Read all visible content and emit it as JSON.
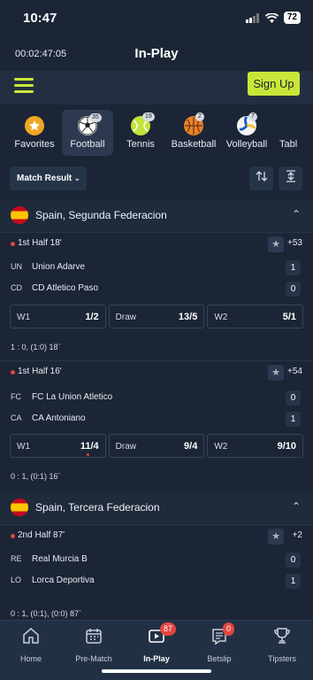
{
  "status_bar": {
    "time": "10:47",
    "battery": "72"
  },
  "top_bar": {
    "timer": "00:02:47:05",
    "title": "In-Play"
  },
  "header": {
    "signup_label": "Sign Up"
  },
  "sports": [
    {
      "label": "Favorites",
      "count": ""
    },
    {
      "label": "Football",
      "count": "35"
    },
    {
      "label": "Tennis",
      "count": "19"
    },
    {
      "label": "Basketball",
      "count": "2"
    },
    {
      "label": "Volleyball",
      "count": "7"
    },
    {
      "label": "Tabl",
      "count": ""
    }
  ],
  "filter": {
    "market_label": "Match Result"
  },
  "leagues": [
    {
      "name": "Spain, Segunda Federacion"
    },
    {
      "name": "Spain, Tercera Federacion"
    }
  ],
  "matches": [
    {
      "period": "1st Half 18'",
      "more": "+53",
      "home": {
        "abbr": "UN",
        "name": "Union Adarve",
        "score": "1"
      },
      "away": {
        "abbr": "CD",
        "name": "CD Atletico Paso",
        "score": "0"
      },
      "odds": [
        {
          "label": "W1",
          "value": "1/2"
        },
        {
          "label": "Draw",
          "value": "13/5"
        },
        {
          "label": "W2",
          "value": "5/1"
        }
      ],
      "info": "1 : 0, (1:0) 18`"
    },
    {
      "period": "1st Half 16'",
      "more": "+54",
      "home": {
        "abbr": "FC",
        "name": "FC La Union Atletico",
        "score": "0"
      },
      "away": {
        "abbr": "CA",
        "name": "CA Antoniano",
        "score": "1"
      },
      "odds": [
        {
          "label": "W1",
          "value": "11/4"
        },
        {
          "label": "Draw",
          "value": "9/4"
        },
        {
          "label": "W2",
          "value": "9/10"
        }
      ],
      "info": "0 : 1, (0:1) 16`"
    },
    {
      "period": "2nd Half 87'",
      "more": "+2",
      "home": {
        "abbr": "RE",
        "name": "Real Murcia B",
        "score": "0"
      },
      "away": {
        "abbr": "LO",
        "name": "Lorca Deportiva",
        "score": "1"
      },
      "info": "0 : 1, (0:1), (0:0) 87`"
    }
  ],
  "tabs": [
    {
      "label": "Home",
      "badge": ""
    },
    {
      "label": "Pre-Match",
      "badge": ""
    },
    {
      "label": "In-Play",
      "badge": "87"
    },
    {
      "label": "Betslip",
      "badge": "0"
    },
    {
      "label": "Tipsters",
      "badge": ""
    }
  ],
  "colors": {
    "accent": "#c8e63a",
    "live": "#e0463f",
    "background": "#1b2535"
  }
}
